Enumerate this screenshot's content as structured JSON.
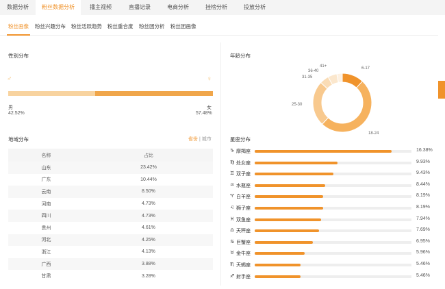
{
  "top_tabs": [
    {
      "label": "数据分析",
      "active": false,
      "new": false
    },
    {
      "label": "粉丝数据分析",
      "active": true,
      "new": false
    },
    {
      "label": "播主视频",
      "active": false,
      "new": false
    },
    {
      "label": "直播记录",
      "active": false,
      "new": true
    },
    {
      "label": "电商分析",
      "active": false,
      "new": true
    },
    {
      "label": "挂榜分析",
      "active": false,
      "new": true
    },
    {
      "label": "投放分析",
      "active": false,
      "new": true
    }
  ],
  "new_badge": "New",
  "sub_tabs": [
    "粉丝画像",
    "粉丝兴趣分布",
    "粉丝活跃趋势",
    "粉丝重合度",
    "粉丝团分析",
    "粉丝团画像"
  ],
  "gender": {
    "title": "性别分布",
    "male_label": "男",
    "female_label": "女",
    "male_pct": "42.52%",
    "female_pct": "57.48%",
    "male_fraction": 0.4252,
    "male_color": "#f8d39f",
    "female_color": "#f0a64a"
  },
  "region": {
    "title": "地域分布",
    "toggle_province": "省份",
    "toggle_sep": "|",
    "toggle_city": "城市",
    "col_name": "名称",
    "col_ratio": "占比",
    "rows": [
      {
        "name": "山东",
        "pct": "23.42%"
      },
      {
        "name": "广东",
        "pct": "10.44%"
      },
      {
        "name": "云南",
        "pct": "8.50%"
      },
      {
        "name": "河南",
        "pct": "4.73%"
      },
      {
        "name": "四川",
        "pct": "4.73%"
      },
      {
        "name": "贵州",
        "pct": "4.61%"
      },
      {
        "name": "河北",
        "pct": "4.25%"
      },
      {
        "name": "浙江",
        "pct": "4.13%"
      },
      {
        "name": "广西",
        "pct": "3.88%"
      },
      {
        "name": "甘肃",
        "pct": "3.28%"
      }
    ]
  },
  "age": {
    "title": "年龄分布",
    "labels": [
      "6-17",
      "18-24",
      "25-30",
      "31-35",
      "36-40",
      "41+"
    ]
  },
  "chart_data": {
    "type": "pie",
    "categories": [
      "6-17",
      "18-24",
      "25-30",
      "31-35",
      "36-40",
      "41+"
    ],
    "values": [
      12,
      50,
      25,
      5,
      5,
      3
    ],
    "colors": [
      "#f0932b",
      "#f6b25e",
      "#f8c98e",
      "#fadcb5",
      "#fbe7cd",
      "#fdf1e2"
    ]
  },
  "zodiac": {
    "title": "星座分布",
    "bar_color": "#f0932b",
    "track_color": "#eeeeee",
    "max": 18.8,
    "items": [
      {
        "icon": "♑",
        "name": "摩羯座",
        "value": 16.38,
        "label": "16.38%"
      },
      {
        "icon": "♍",
        "name": "处女座",
        "value": 9.93,
        "label": "9.93%"
      },
      {
        "icon": "♊",
        "name": "双子座",
        "value": 9.43,
        "label": "9.43%"
      },
      {
        "icon": "♒",
        "name": "水瓶座",
        "value": 8.44,
        "label": "8.44%"
      },
      {
        "icon": "♈",
        "name": "白羊座",
        "value": 8.19,
        "label": "8.19%"
      },
      {
        "icon": "♌",
        "name": "狮子座",
        "value": 8.19,
        "label": "8.19%"
      },
      {
        "icon": "♓",
        "name": "双鱼座",
        "value": 7.94,
        "label": "7.94%"
      },
      {
        "icon": "♎",
        "name": "天秤座",
        "value": 7.69,
        "label": "7.69%"
      },
      {
        "icon": "♋",
        "name": "巨蟹座",
        "value": 6.95,
        "label": "6.95%"
      },
      {
        "icon": "♉",
        "name": "金牛座",
        "value": 5.96,
        "label": "5.96%"
      },
      {
        "icon": "♏",
        "name": "天蝎座",
        "value": 5.46,
        "label": "5.46%"
      },
      {
        "icon": "♐",
        "name": "射手座",
        "value": 5.46,
        "label": "5.46%"
      }
    ]
  }
}
